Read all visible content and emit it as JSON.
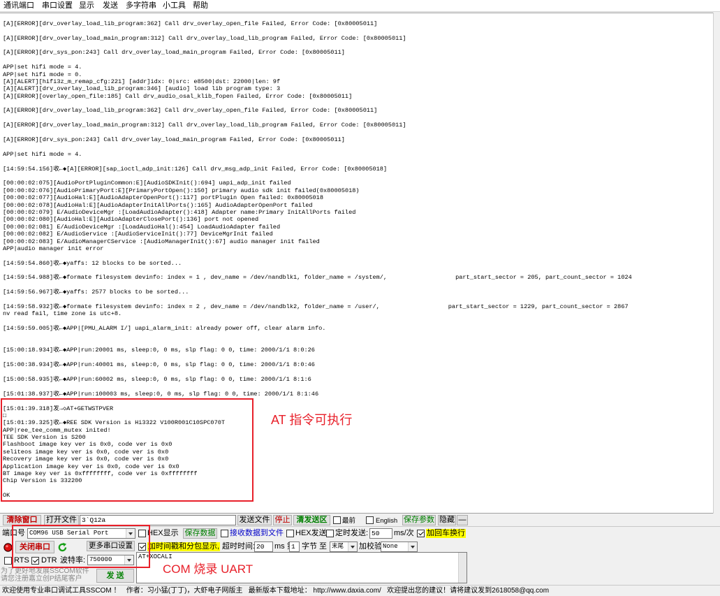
{
  "colors": {
    "annotation": "#e8202a",
    "highlight": "#ffff00",
    "green_label": "#008000",
    "red_label": "#c00000",
    "blue_label": "#0000c8"
  },
  "menu": {
    "items": [
      "通讯端口",
      "串口设置",
      "显示",
      "发送",
      "多字符串",
      "小工具",
      "帮助"
    ]
  },
  "log": {
    "lines": [
      "[A][ERROR][drv_overlay_load_lib_program:362] Call drv_overlay_open_file Failed, Error Code: [0x80005011]",
      "",
      "[A][ERROR][drv_overlay_load_main_program:312] Call drv_overlay_load_lib_program Failed, Error Code: [0x80005011]",
      "",
      "[A][ERROR][drv_sys_pon:243] Call drv_overlay_load_main_program Failed, Error Code: [0x80005011]",
      "",
      "APP|set hifi mode = 4.",
      "APP|set hifi mode = 0.",
      "[A][ALERT][hifi3z_m_remap_cfg:221] [addr]idx: 0|src: e8500|dst: 22000|len: 9f",
      "[A][ALERT][drv_overlay_load_lib_program:346] [audio] load lib program type: 3",
      "[A][ERROR][overlay_open_file:185] Call drv_audio_osal_klib_fopen Failed, Error Code: [0x80005011]",
      "",
      "[A][ERROR][drv_overlay_load_lib_program:362] Call drv_overlay_open_file Failed, Error Code: [0x80005011]",
      "",
      "[A][ERROR][drv_overlay_load_main_program:312] Call drv_overlay_load_lib_program Failed, Error Code: [0x80005011]",
      "",
      "[A][ERROR][drv_sys_pon:243] Call drv_overlay_load_main_program Failed, Error Code: [0x80005011]",
      "",
      "APP|set hifi mode = 4.",
      "",
      "[14:59:54.156]收←◆[A][ERROR][sap_ioctl_adp_init:126] Call drv_msg_adp_init Failed, Error Code: [0x80005018]",
      "",
      "[00:00:02:075][AudioPortPluginCommon:E][AudioSDKInit():694] uapi_adp_init failed",
      "[00:00:02:076][AudioPrimaryPort:E][PrimaryPortOpen():150] primary audio sdk init failed(0x80005018)",
      "[00:00:02:077][AudioHal:E][AudioAdapterOpenPort():117] portPlugin Open failed: 0x80005018",
      "[00:00:02:078][AudioHal:E][AudioAdapterInitAllPorts():165] AudioAdapterOpenPort failed",
      "[00:00:02:079] E/AudioDeviceMgr :[LoadAudioAdapter():418] Adapter name:Primary InitAllPorts failed",
      "[00:00:02:080][AudioHal:E][AudioAdapterClosePort():136] port not opened",
      "[00:00:02:081] E/AudioDeviceMgr :[LoadAudioHal():454] LoadAudioAdapter failed",
      "[00:00:02:082] E/AudioService :[AudioServiceInit():77] DeviceMgrInit failed",
      "[00:00:02:083] E/AudioManagerCService :[AudioManagerInit():67] audio manager init failed",
      "APP|audio manager init error",
      "",
      "[14:59:54.860]收←◆yaffs: 12 blocks to be sorted...",
      "",
      "[14:59:54.988]收←◆formate filesystem devinfo: index = 1 , dev_name = /dev/nandblk1, folder_name = /system/,                   part_start_sector = 205, part_count_sector = 1024",
      "",
      "[14:59:56.967]收←◆yaffs: 2577 blocks to be sorted...",
      "",
      "[14:59:58.932]收←◆formate filesystem devinfo: index = 2 , dev_name = /dev/nandblk2, folder_name = /user/,                   part_start_sector = 1229, part_count_sector = 2867",
      "nv read fail, time zone is utc+8.",
      "",
      "[14:59:59.005]收←◆APP|[PMU_ALARM I/] uapi_alarm_init: already power off, clear alarm info.",
      "",
      "",
      "[15:00:18.934]收←◆APP|run:20001 ms, sleep:0, 0 ms, slp flag: 0 0, time: 2000/1/1 8:0:26",
      "",
      "[15:00:38.934]收←◆APP|run:40001 ms, sleep:0, 0 ms, slp flag: 0 0, time: 2000/1/1 8:0:46",
      "",
      "[15:00:58.935]收←◆APP|run:60002 ms, sleep:0, 0 ms, slp flag: 0 0, time: 2000/1/1 8:1:6",
      "",
      "[15:01:38.937]收←◆APP|run:100003 ms, sleep:0, 0 ms, slp flag: 0 0, time: 2000/1/1 8:1:46",
      "",
      "[15:01:39.318]发→◇AT+GETWSTPVER",
      "□",
      "[15:01:39.325]收←◆REE SDK Version is Hi3322 V100R001C10SPC070T",
      "APP|ree_tee_comm_mutex inited!",
      "TEE SDK Version is S200",
      "Flashboot image key ver is 0x0, code ver is 0x0",
      "seliteos image key ver is 0x0, code ver is 0x0",
      "Recovery image key ver is 0x0, code ver is 0x0",
      "Application image key ver is 0x0, code ver is 0x0",
      "BT image key ver is 0xffffffff, code ver is 0xffffffff",
      "Chip Version is 332200",
      "",
      "OK"
    ]
  },
  "annotations": {
    "at_commands": "AT 指令可执行",
    "com_uart": "COM 烧录 UART"
  },
  "toolbar": {
    "clear_window": "清除窗口",
    "open_file": "打开文件",
    "file_path": "3`Q12a",
    "send_file": "发送文件",
    "stop": "停止",
    "clear_send": "清发送区",
    "topmost": {
      "label": "最前",
      "checked": false
    },
    "english": {
      "label": "English",
      "checked": false
    },
    "save_params": "保存参数",
    "hide": "隐藏",
    "minimize": "—"
  },
  "port": {
    "label": "端口号",
    "selected": "COM96 USB Serial Port",
    "open_close": "关闭串口",
    "more_settings": "更多串口设置",
    "rts": {
      "label": "RTS",
      "checked": false
    },
    "dtr": {
      "label": "DTR",
      "checked": true
    },
    "baud_label": "波特率:",
    "baud": "750000"
  },
  "options": {
    "hex_display": {
      "label": "HEX显示",
      "checked": false
    },
    "save_data": "保存数据",
    "recv_to_file": {
      "label": "接收数据到文件",
      "checked": false
    },
    "hex_send": {
      "label": "HEX发送",
      "checked": false
    },
    "timed_send": {
      "label": "定时发送:",
      "checked": false
    },
    "interval": "50",
    "interval_unit": "ms/次",
    "crlf": {
      "label": "加回车换行",
      "checked": true
    },
    "timestamp": {
      "label": "加时间戳和分包显示,",
      "checked": true
    },
    "timeout_label": "超时时间:",
    "timeout": "20",
    "from_label": "ms 第",
    "byte_from": "1",
    "to_label": "字节 至",
    "byte_to": "末尾",
    "checksum_label": "加校验",
    "checksum": "None"
  },
  "send": {
    "text": "AT+XOCALI",
    "button": "发 送"
  },
  "promo": {
    "line1": "为了更好地发展SSCOM软件",
    "line2": "请您注册嘉立创P结尾客户"
  },
  "status_bar": {
    "text": "欢迎使用专业串口调试工具SSCOM ！   作者：习小猛(丁丁)，大虾电子网版主   最新版本下载地址： http://www.daxia.com/   欢迎提出您的建议！请将建议发到2618058@qq.com"
  }
}
